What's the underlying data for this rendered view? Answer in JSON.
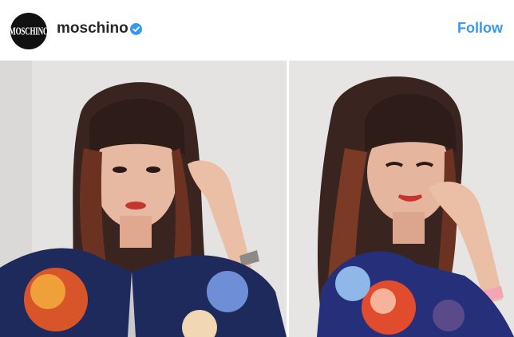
{
  "header": {
    "avatar_text": "MOSCHINO",
    "username": "moschino",
    "follow_label": "Follow"
  },
  "photos": [
    {
      "subject": "photo-left"
    },
    {
      "subject": "photo-right"
    }
  ],
  "colors": {
    "follow": "#3897f0",
    "verified": "#3897f0",
    "username": "#262626",
    "background": "#e3e2e0"
  }
}
